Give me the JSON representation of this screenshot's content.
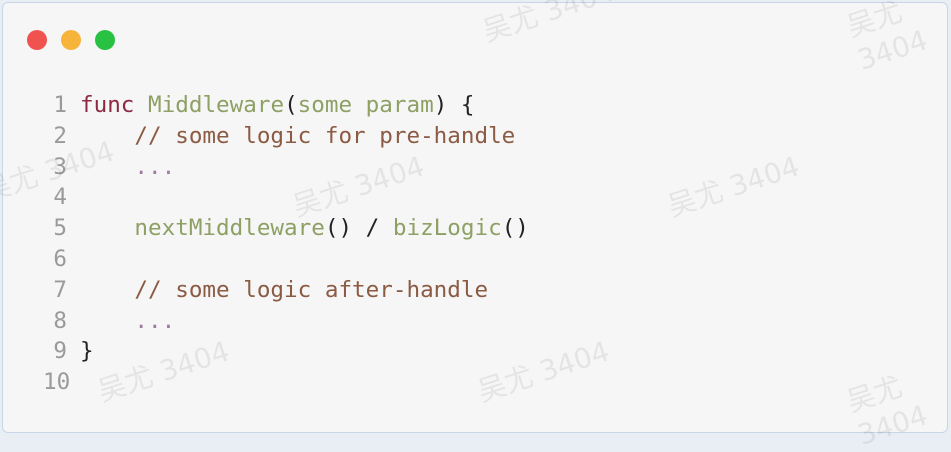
{
  "window": {
    "controls": [
      {
        "name": "close",
        "color": "#f0524f"
      },
      {
        "name": "minimize",
        "color": "#f6b53a"
      },
      {
        "name": "maximize",
        "color": "#29c141"
      }
    ]
  },
  "watermark": "吴尤 3404",
  "code": {
    "lines": [
      {
        "n": "1",
        "tokens": [
          {
            "t": "func",
            "c": "kw"
          },
          {
            "t": " ",
            "c": "pl"
          },
          {
            "t": "Middleware",
            "c": "fn"
          },
          {
            "t": "(",
            "c": "pl"
          },
          {
            "t": "some param",
            "c": "fn"
          },
          {
            "t": ") {",
            "c": "pl"
          }
        ]
      },
      {
        "n": "2",
        "tokens": [
          {
            "t": "    // some logic for pre-handle",
            "c": "cm"
          }
        ]
      },
      {
        "n": "3",
        "tokens": [
          {
            "t": "    ...",
            "c": "dd"
          }
        ]
      },
      {
        "n": "4",
        "tokens": []
      },
      {
        "n": "5",
        "tokens": [
          {
            "t": "    nextMiddleware",
            "c": "fn"
          },
          {
            "t": "() / ",
            "c": "pl"
          },
          {
            "t": "bizLogic",
            "c": "fn"
          },
          {
            "t": "()",
            "c": "pl"
          }
        ]
      },
      {
        "n": "6",
        "tokens": []
      },
      {
        "n": "7",
        "tokens": [
          {
            "t": "    // some logic after-handle",
            "c": "cm"
          }
        ]
      },
      {
        "n": "8",
        "tokens": [
          {
            "t": "    ...",
            "c": "dd"
          }
        ]
      },
      {
        "n": "9",
        "tokens": [
          {
            "t": "}",
            "c": "pl"
          }
        ]
      },
      {
        "n": "10",
        "tokens": []
      }
    ]
  }
}
